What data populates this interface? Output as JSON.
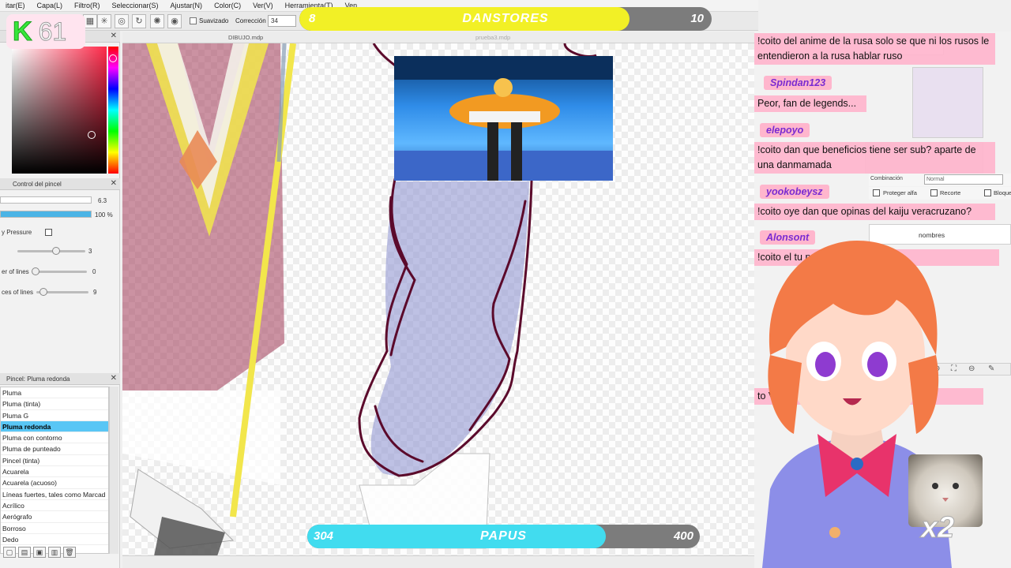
{
  "menu": [
    "itar(E)",
    "Capa(L)",
    "Filtro(R)",
    "Seleccionar(S)",
    "Ajustar(N)",
    "Color(C)",
    "Ver(V)",
    "Herramienta(T)",
    "Ven"
  ],
  "toolbar": {
    "smooth_label": "Suavizado",
    "correction_label": "Corrección",
    "correction_value": "34"
  },
  "documents": [
    "DIBUJO.mdp",
    "prueba3.mdp"
  ],
  "panels": {
    "brush_control": "Control del pincel",
    "size_value": "6.3",
    "opacity_value": "100 %",
    "pressure_label": "y Pressure",
    "slider1_value": "3",
    "lines_label": "er of lines",
    "lines_value": "0",
    "spaces_label": "ces of lines",
    "spaces_value": "9",
    "brush_header": "Pincel: Pluma redonda"
  },
  "brushes": [
    "Pluma",
    "Pluma (tinta)",
    "Pluma G",
    "Pluma redonda",
    "Pluma con contorno",
    "Pluma de punteado",
    "Pincel (tinta)",
    "Acuarela",
    "Acuarela (acuoso)",
    "Líneas fuertes, tales como Marcad",
    "Acrílico",
    "Aerógrafo",
    "Borroso",
    "Dedo"
  ],
  "selected_brush_index": 3,
  "counter": {
    "letter": "K",
    "value": "61"
  },
  "top_goal": {
    "current": "8",
    "title": "DANSTORES",
    "target": "10",
    "progress": 0.8,
    "color": "#f2f026"
  },
  "bottom_goal": {
    "current": "304",
    "title": "PAPUS",
    "target": "400",
    "progress": 0.76,
    "color": "#41dcef"
  },
  "chat": [
    {
      "user": "",
      "text": "!coito del anime de la rusa solo se que ni los rusos le entendieron a la rusa hablar ruso"
    },
    {
      "user": "Spindan123",
      "text": "Peor, fan de legends..."
    },
    {
      "user": "elepoyo",
      "text": "!coito dan que beneficios tiene ser sub? aparte de una danmamada"
    },
    {
      "user": "yookobeysz",
      "text": "!coito oye dan que opinas del kaiju veracruzano?"
    },
    {
      "user": "Alonsont",
      "text": "!coito el tu puta madre"
    },
    {
      "user": "",
      "text": "to Vo... ors scouts aban n... or"
    }
  ],
  "right_panel": {
    "combination_label": "Combinación",
    "combination_value": "Normal",
    "protect_alpha": "Proteger alfa",
    "clip": "Recorte",
    "lock": "Bloque",
    "layer_name": "nombres"
  },
  "multiplier": "x2",
  "colors": {
    "accent": "#59c6f5",
    "chat_bg": "#ffb6cd",
    "username": "#7a2bd1"
  }
}
